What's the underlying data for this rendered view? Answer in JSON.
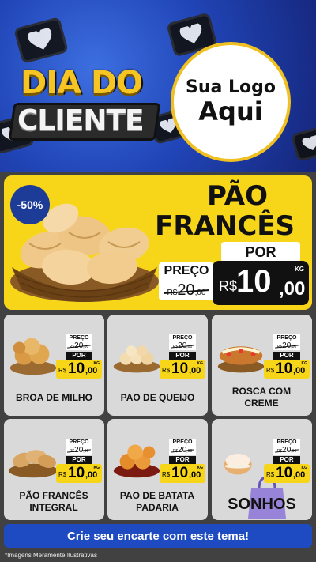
{
  "header": {
    "title_line1": "DIA DO",
    "title_line2": "CLIENTE",
    "logo_line1": "Sua Logo",
    "logo_line2": "Aqui"
  },
  "hero": {
    "discount": "-50%",
    "name_line1": "PÃO",
    "name_line2": "FRANCÊS",
    "preco_label": "PREÇO",
    "old_price": "20",
    "old_cents": ",00",
    "por_label": "POR",
    "currency": "R$",
    "new_price": "10",
    "new_cents": ",00",
    "unit": "KG"
  },
  "products": [
    {
      "name": "BROA DE MILHO",
      "preco_label": "PREÇO",
      "old_price": "20",
      "old_cents": ",00",
      "old_currency": "R$",
      "por_label": "POR",
      "currency": "R$",
      "price": "10",
      "cents": ",00",
      "unit": "KG"
    },
    {
      "name": "PAO DE QUEIJO",
      "preco_label": "PREÇO",
      "old_price": "20",
      "old_cents": ",00",
      "old_currency": "R$",
      "por_label": "POR",
      "currency": "R$",
      "price": "10",
      "cents": ",00",
      "unit": "KG"
    },
    {
      "name": "ROSCA COM CREME",
      "preco_label": "PREÇO",
      "old_price": "20",
      "old_cents": ",00",
      "old_currency": "R$",
      "por_label": "POR",
      "currency": "R$",
      "price": "10",
      "cents": ",00",
      "unit": "KG"
    },
    {
      "name": "PÃO FRANCÊS INTEGRAL",
      "preco_label": "PREÇO",
      "old_price": "20",
      "old_cents": ",00",
      "old_currency": "R$",
      "por_label": "POR",
      "currency": "R$",
      "price": "10",
      "cents": ",00",
      "unit": "KG"
    },
    {
      "name": "PAO DE BATATA PADARIA",
      "preco_label": "PREÇO",
      "old_price": "20",
      "old_cents": ",00",
      "old_currency": "R$",
      "por_label": "POR",
      "currency": "R$",
      "price": "10",
      "cents": ",00",
      "unit": "KG"
    },
    {
      "name": "SONHOS",
      "preco_label": "PREÇO",
      "old_price": "20",
      "old_cents": ",00",
      "old_currency": "R$",
      "por_label": "POR",
      "currency": "R$",
      "price": "10",
      "cents": ",00",
      "unit": "KG"
    }
  ],
  "footer": {
    "cta": "Crie seu encarte com este tema!",
    "disclaimer": "*Imagens Meramente Ilustrativas"
  },
  "colors": {
    "header_blue": "#2146b8",
    "accent_yellow": "#f7d61a",
    "card_gray": "#d9d9d9",
    "cta_blue": "#1e4bc2"
  }
}
